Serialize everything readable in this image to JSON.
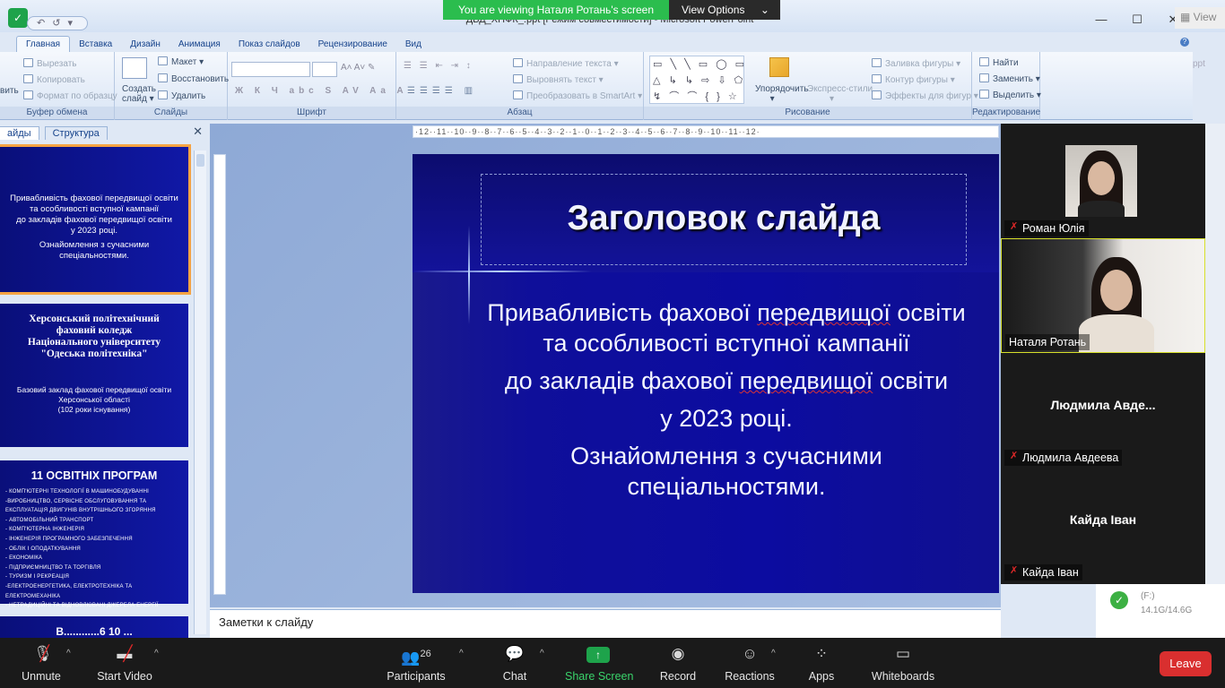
{
  "banner": {
    "viewing_text": "You are viewing Наталя Ротань's screen",
    "view_options": "View Options",
    "corner_view": "View"
  },
  "window": {
    "title": "ДВД_ХПФК_.ppt [Режим совместимости] - Microsoft PowerPoint"
  },
  "ribbon": {
    "tabs": [
      "Главная",
      "Вставка",
      "Дизайн",
      "Анимация",
      "Показ слайдов",
      "Рецензирование",
      "Вид"
    ],
    "clipboard": {
      "cut": "Вырезать",
      "copy": "Копировать",
      "format": "Формат по образцу",
      "paste_partial": "вить",
      "label": "Буфер обмена"
    },
    "slides": {
      "create_line1": "Создать",
      "create_line2": "слайд",
      "layout": "Макет",
      "restore": "Восстановить",
      "delete": "Удалить",
      "label": "Слайды"
    },
    "font": {
      "label": "Шрифт"
    },
    "paragraph": {
      "direction": "Направление текста",
      "align": "Выровнять текст",
      "smartart": "Преобразовать в SmartArt",
      "label": "Абзац"
    },
    "drawing": {
      "arrange": "Упорядочить",
      "styles": "Экспресс-стили",
      "fill": "Заливка фигуры",
      "outline": "Контур фигуры",
      "effects": "Эффекты для фигур",
      "label": "Рисование"
    },
    "editing": {
      "find": "Найти",
      "replace": "Заменить",
      "select": "Выделить",
      "label": "Редактирование"
    }
  },
  "slides_panel": {
    "tab_slides": "айды",
    "tab_outline": "Структура",
    "thumb1_lines": [
      "Привабливість фахової передвищої освіти",
      "та особливості вступної кампанії",
      "до закладів фахової передвищої освіти",
      "у 2023 році.",
      "Ознайомлення з сучасними",
      "спеціальностями."
    ],
    "thumb2_title": [
      "Херсонський політехнічний",
      "фаховий коледж",
      "Національного університету",
      "\"Одеська політехніка\""
    ],
    "thumb2_sub": [
      "Базовий заклад фахової передвищої освіти",
      "Херсонської області",
      "(102 роки існування)"
    ],
    "thumb3_title": "11 ОСВІТНІХ ПРОГРАМ",
    "thumb3_items": [
      "- Комп'ютерні технології в машинобудуванні",
      "-Виробництво, сервісне обслуговування та",
      "експлуатація двигунів внутрішнього згоряння",
      "- Автомобільний транспорт",
      "- Комп'ютерна інженерія",
      "- Інженерія програмного забезпечення",
      "- Облік і оподаткування",
      "- Економіка",
      "- Підприємництво та торгівля",
      "- Туризм і рекреація",
      "-Електроенергетика, електротехніка та електромеханіка",
      "- Нетрадиційні та відновлювані джерела енергії"
    ],
    "thumb4_partial": "В............6 10 ..."
  },
  "ruler": {
    "marks": "·12··11··10··9··8··7··6··5··4··3··2··1··0··1··2··3··4··5··6··7··8··9··10··11··12·"
  },
  "slide": {
    "title": "Заголовок слайда",
    "line1_a": "Привабливість фахової ",
    "line1_u": "передвищої",
    "line1_b": " освіти",
    "line2": "та особливості  вступної кампанії",
    "line3_a": "до закладів фахової ",
    "line3_u": "передвищої",
    "line3_b": " освіти",
    "line4": "у 2023 році.",
    "line5": "Ознайомлення   з сучасними",
    "line6": "спеціальностями."
  },
  "notes": {
    "placeholder": "Заметки к слайду"
  },
  "participants": [
    {
      "name": "Роман Юлія",
      "muted": true
    },
    {
      "name": "Наталя Ротань",
      "muted": false
    },
    {
      "name": "Людмила Авдеева",
      "display": "Людмила  Авде...",
      "muted": true
    },
    {
      "name": "Кайда Іван",
      "display": "Кайда Іван",
      "muted": true
    }
  ],
  "peek": {
    "drive": "(F:)",
    "size": "14.1G/14.6G"
  },
  "toolbar": {
    "unmute": "Unmute",
    "start_video": "Start Video",
    "participants": "Participants",
    "participants_count": "26",
    "chat": "Chat",
    "share_screen": "Share Screen",
    "record": "Record",
    "reactions": "Reactions",
    "apps": "Apps",
    "whiteboards": "Whiteboards",
    "leave": "Leave"
  },
  "colors": {
    "accent_green": "#2bbd4e",
    "leave_red": "#d92f2f",
    "slide_blue": "#0c0ca0"
  }
}
